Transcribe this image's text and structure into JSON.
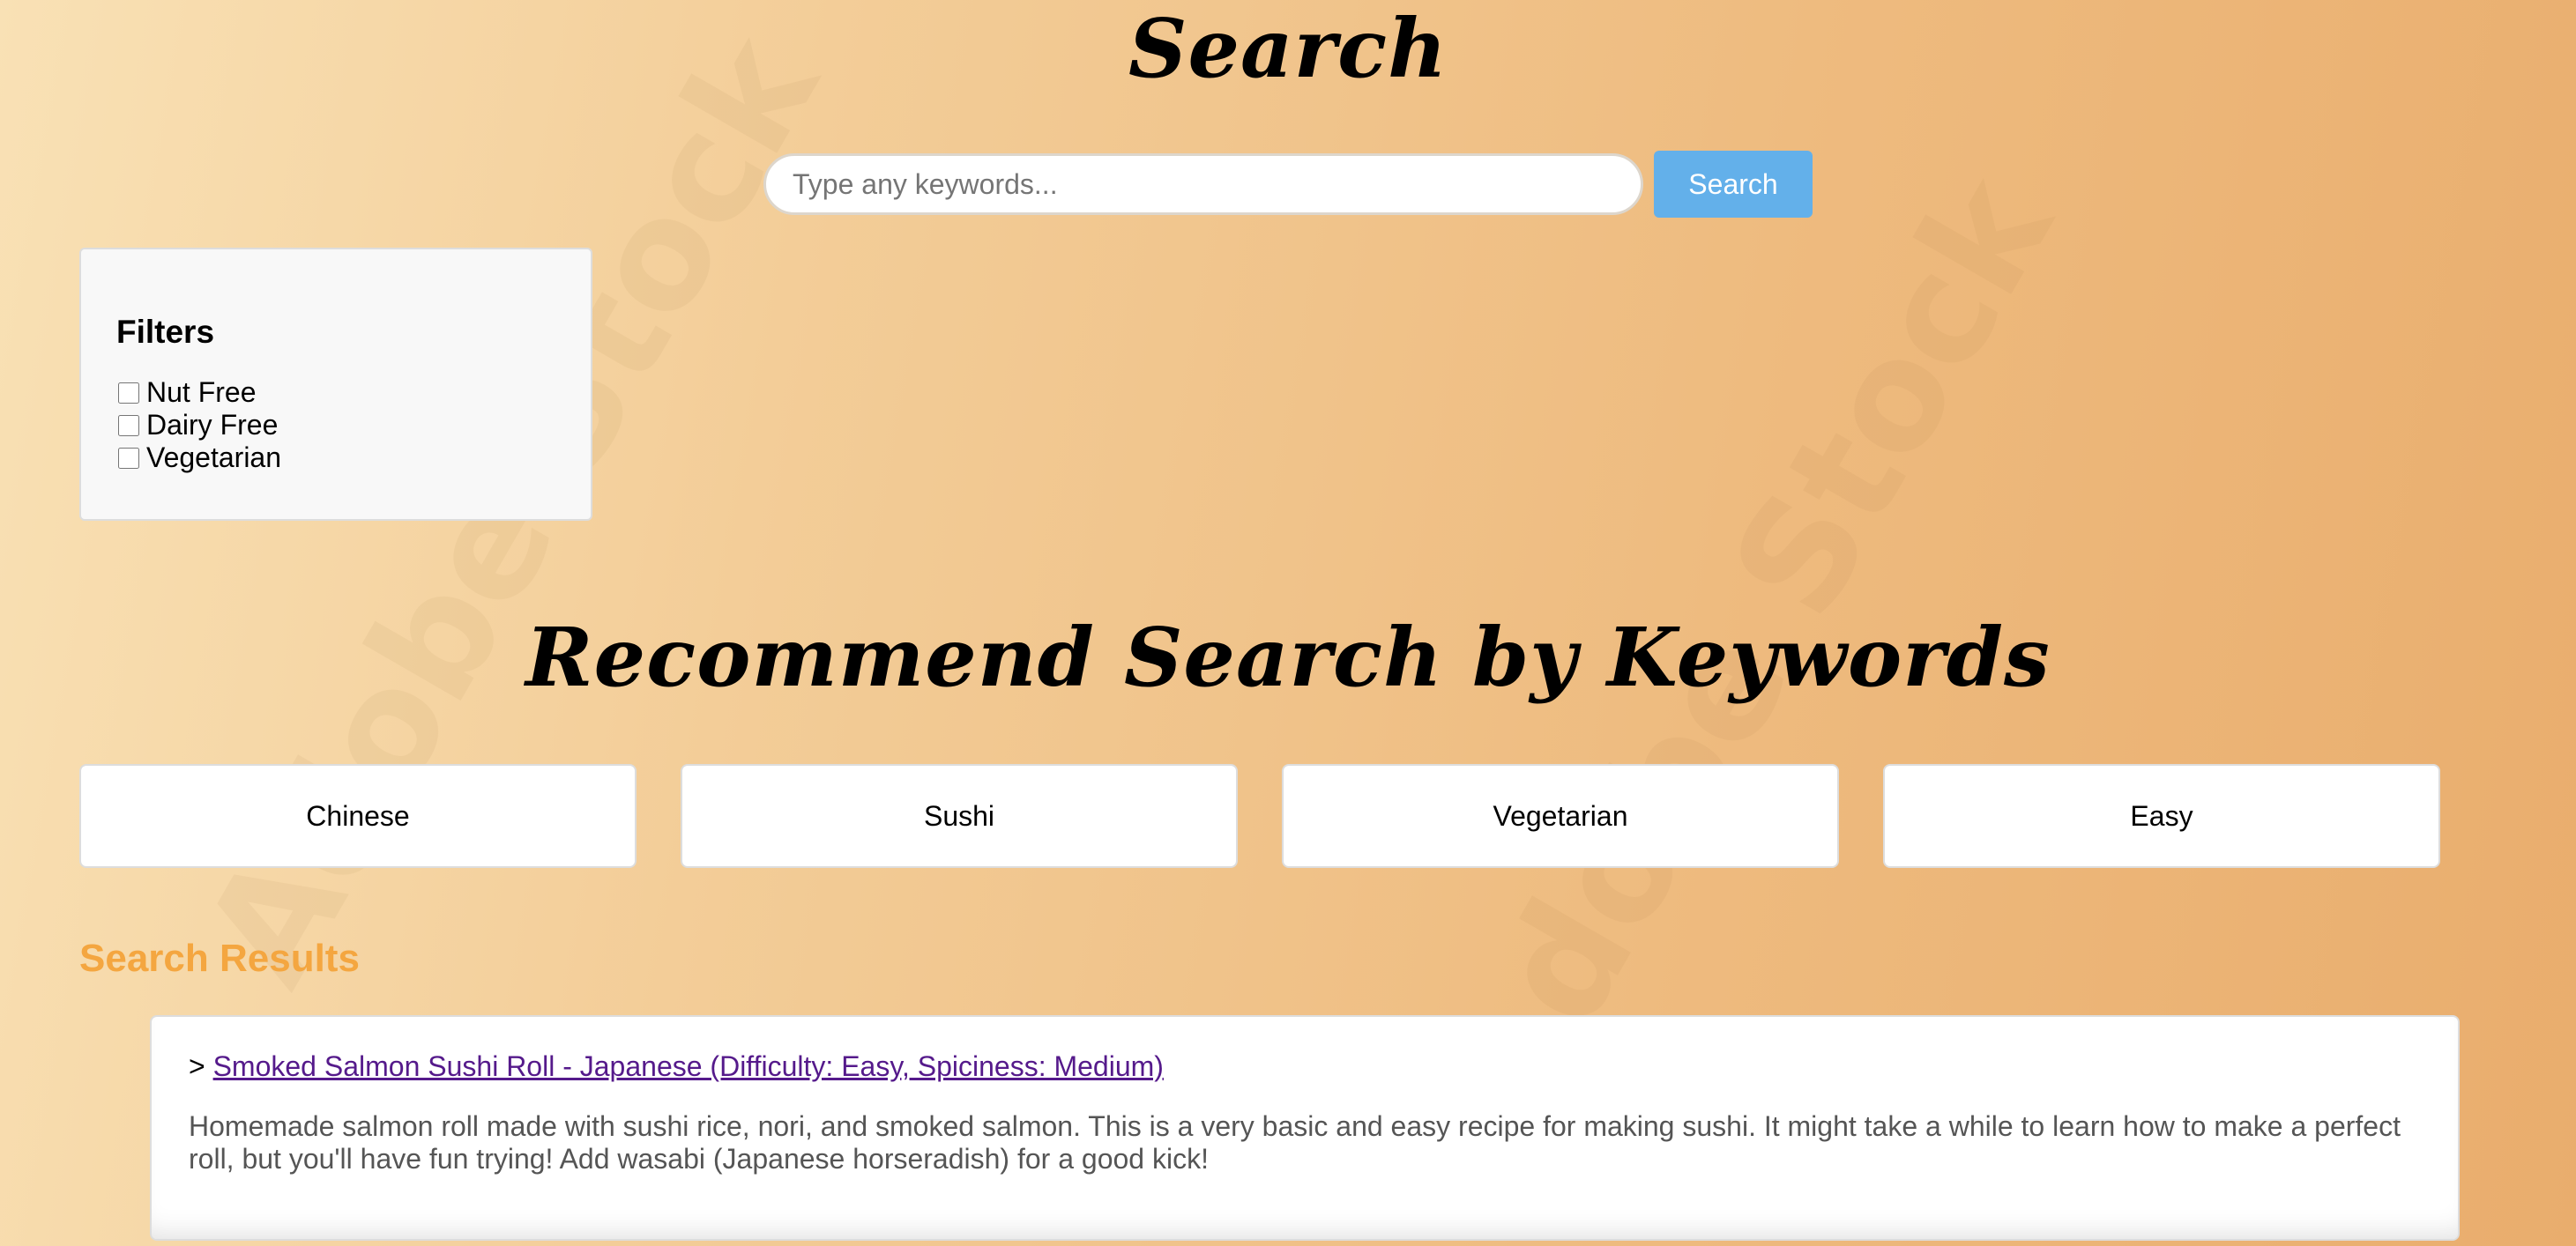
{
  "header": {
    "title": "Search"
  },
  "search": {
    "placeholder": "Type any keywords...",
    "button_label": "Search"
  },
  "filters": {
    "title": "Filters",
    "options": [
      {
        "label": "Nut Free",
        "checked": false
      },
      {
        "label": "Dairy Free",
        "checked": false
      },
      {
        "label": "Vegetarian",
        "checked": false
      }
    ]
  },
  "recommend": {
    "title": "Recommend Search by Keywords",
    "keywords": [
      "Chinese",
      "Sushi",
      "Vegetarian",
      "Easy"
    ]
  },
  "results": {
    "title": "Search Results",
    "title_color": "#f4a640",
    "items": [
      {
        "prefix": ">",
        "link_text": "Smoked Salmon Sushi Roll - Japanese (Difficulty: Easy, Spiciness: Medium)",
        "description": "Homemade salmon roll made with sushi rice, nori, and smoked salmon. This is a very basic and easy recipe for making sushi. It might take a while to learn how to make a perfect roll, but you'll have fun trying! Add wasabi (Japanese horseradish) for a good kick!"
      }
    ]
  },
  "watermark": {
    "text": "Adobe Stock"
  },
  "colors": {
    "search_button": "#63b0ea",
    "link": "#551a8b"
  }
}
